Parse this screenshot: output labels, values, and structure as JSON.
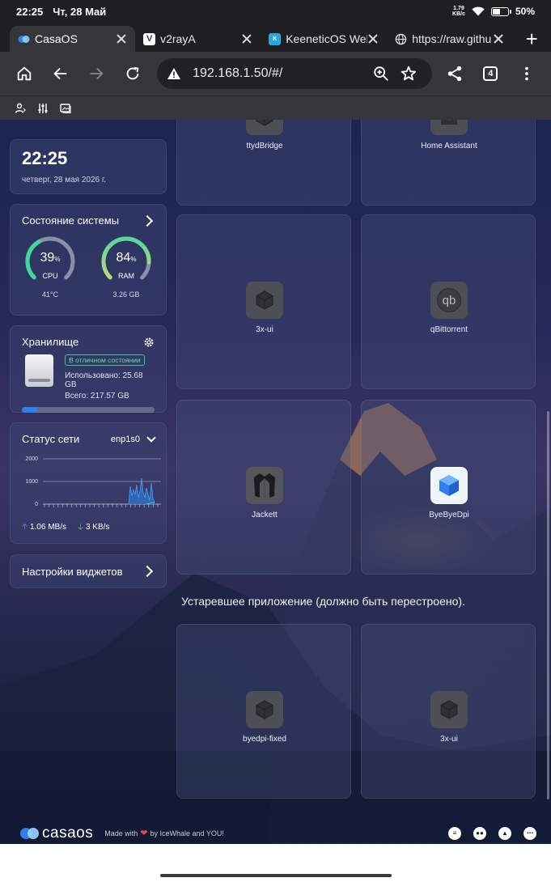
{
  "statusbar": {
    "time": "22:25",
    "date": "Чт, 28 Май",
    "net_speed_value": "1.79",
    "net_speed_unit": "KB/c",
    "battery": "50%"
  },
  "tabs": [
    {
      "title": "CasaOS",
      "active": true
    },
    {
      "title": "v2rayA",
      "active": false
    },
    {
      "title": "KeeneticOS Web",
      "active": false
    },
    {
      "title": "https://raw.githu",
      "active": false
    }
  ],
  "toolbar": {
    "url": "192.168.1.50/#/",
    "tab_count": "4"
  },
  "clock": {
    "time": "22:25",
    "date": "четверг, 28 мая 2026 г."
  },
  "system_status": {
    "title": "Состояние системы",
    "cpu": {
      "value": "39",
      "unit": "%",
      "label": "CPU",
      "sub": "41°C",
      "percent": 39
    },
    "ram": {
      "value": "84",
      "unit": "%",
      "label": "RAM",
      "sub": "3.26 GB",
      "percent": 84
    }
  },
  "storage": {
    "title": "Хранилище",
    "badge": "В отличном состоянии",
    "used": "Использовано: 25.68 GB",
    "total": "Всего: 217.57 GB",
    "used_fraction": 0.118
  },
  "network": {
    "title": "Статус сети",
    "interface": "enp1s0",
    "y_ticks": [
      "2000",
      "1000",
      "0"
    ],
    "upload": "1.06 MB/s",
    "download": "3 KB/s"
  },
  "widget_settings": {
    "label": "Настройки виджетов"
  },
  "apps": [
    {
      "name": "ttydBridge"
    },
    {
      "name": "Home Assistant"
    },
    {
      "name": "3x-ui"
    },
    {
      "name": "qBittorrent"
    },
    {
      "name": "Jackett"
    },
    {
      "name": "ByeByeDpi"
    }
  ],
  "legacy_section": {
    "title": "Устаревшее приложение (должно быть перестроено).",
    "apps": [
      {
        "name": "byedpi-fixed"
      },
      {
        "name": "3x-ui"
      }
    ]
  },
  "footer": {
    "logo_text": "casaos",
    "made_with": "Made with",
    "by": "by IceWhale and YOU!"
  },
  "colors": {
    "accent": "#2f80ed",
    "gauge_green": "#3fd9a0",
    "gauge_yellow": "#e8d870",
    "healthy": "#4bc08d"
  }
}
